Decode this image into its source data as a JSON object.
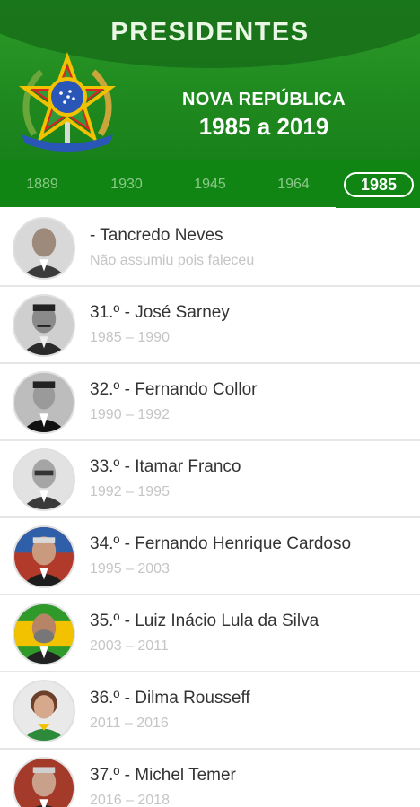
{
  "header": {
    "title": "PRESIDENTES",
    "era_name": "NOVA REPÚBLICA",
    "era_years": "1985 a 2019"
  },
  "tabs": [
    {
      "label": "1889",
      "active": false
    },
    {
      "label": "1930",
      "active": false
    },
    {
      "label": "1945",
      "active": false
    },
    {
      "label": "1964",
      "active": false
    },
    {
      "label": "1985",
      "active": true
    }
  ],
  "presidents": [
    {
      "name": "- Tancredo Neves",
      "term": "Não assumiu pois faleceu"
    },
    {
      "name": "31.º - José Sarney",
      "term": "1985 – 1990"
    },
    {
      "name": "32.º - Fernando Collor",
      "term": "1990 – 1992"
    },
    {
      "name": "33.º - Itamar Franco",
      "term": "1992 – 1995"
    },
    {
      "name": "34.º - Fernando Henrique Cardoso",
      "term": "1995 – 2003"
    },
    {
      "name": "35.º - Luiz Inácio Lula da Silva",
      "term": "2003 – 2011"
    },
    {
      "name": "36.º - Dilma Rousseff",
      "term": "2011 – 2016"
    },
    {
      "name": "37.º - Michel Temer",
      "term": "2016 – 2018"
    }
  ],
  "colors": {
    "header_green": "#1f8a1f",
    "tab_bar_green": "#108513",
    "tab_inactive": "#8cc98b",
    "name_text": "#333333",
    "term_text": "#c5c5c5"
  }
}
